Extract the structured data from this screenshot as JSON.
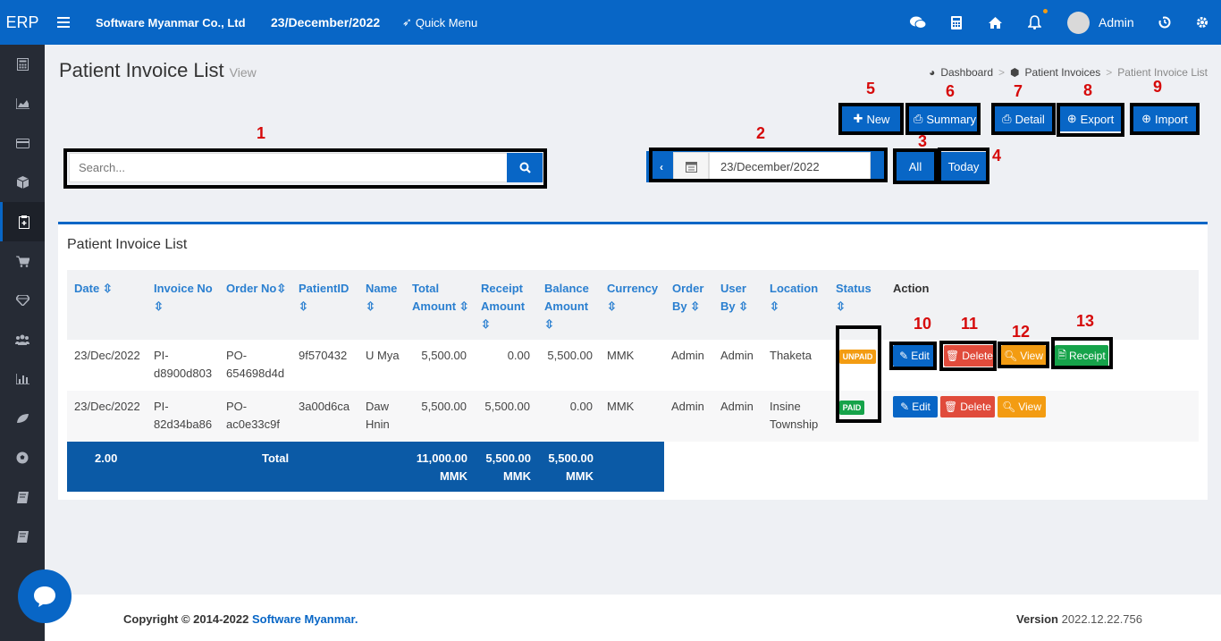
{
  "topbar": {
    "logo": "ERP",
    "company": "Software Myanmar Co., Ltd",
    "date": "23/December/2022",
    "quick_menu": "Quick Menu",
    "user": "Admin"
  },
  "page": {
    "title": "Patient Invoice List",
    "subtitle": "View",
    "breadcrumb": [
      "Dashboard",
      "Patient Invoices",
      "Patient Invoice List"
    ]
  },
  "toolbar": {
    "new": "New",
    "summary": "Summary",
    "detail": "Detail",
    "export": "Export",
    "import": "Import",
    "all": "All",
    "today": "Today"
  },
  "search": {
    "placeholder": "Search..."
  },
  "datefilter": {
    "value": "23/December/2022"
  },
  "annotations": [
    "1",
    "2",
    "3",
    "4",
    "5",
    "6",
    "7",
    "8",
    "9",
    "10",
    "11",
    "12",
    "13"
  ],
  "panel": {
    "title": "Patient Invoice List"
  },
  "table": {
    "headers": {
      "date": "Date",
      "invoice_no": "Invoice No",
      "order_no": "Order No",
      "patient_id": "PatientID",
      "name": "Name",
      "total_amount_1": "Total",
      "total_amount_2": "Amount",
      "receipt_amount_1": "Receipt",
      "receipt_amount_2": "Amount",
      "balance_amount_1": "Balance",
      "balance_amount_2": "Amount",
      "currency": "Currency",
      "order_by_1": "Order",
      "order_by_2": "By",
      "user_by_1": "User",
      "user_by_2": "By",
      "location": "Location",
      "status": "Status",
      "action": "Action"
    },
    "rows": [
      {
        "date": "23/Dec/2022",
        "inv1": "PI-",
        "inv2": "d8900d803",
        "ord1": "PO-",
        "ord2": "654698d4d",
        "pid": "9f570432",
        "name1": "U Mya",
        "name2": "",
        "total": "5,500.00",
        "receipt": "0.00",
        "balance": "5,500.00",
        "currency": "MMK",
        "order_by": "Admin",
        "user_by": "Admin",
        "loc1": "Thaketa",
        "loc2": "",
        "status": "UNPAID"
      },
      {
        "date": "23/Dec/2022",
        "inv1": "PI-",
        "inv2": "82d34ba86",
        "ord1": "PO-",
        "ord2": "ac0e33c9f",
        "pid": "3a00d6ca",
        "name1": "Daw",
        "name2": "Hnin",
        "total": "5,500.00",
        "receipt": "5,500.00",
        "balance": "0.00",
        "currency": "MMK",
        "order_by": "Admin",
        "user_by": "Admin",
        "loc1": "Insine",
        "loc2": "Township",
        "status": "PAID"
      }
    ],
    "actions": {
      "edit": "Edit",
      "delete": "Delete",
      "view": "View",
      "receipt": "Receipt"
    },
    "total_row": {
      "count": "2.00",
      "label": "Total",
      "total": "11,000.00",
      "receipt": "5,500.00",
      "balance": "5,500.00",
      "unit": "MMK"
    }
  },
  "footer": {
    "copyright": "Copyright © 2014-2022",
    "company": "Software Myanmar.",
    "version_label": "Version",
    "version": "2022.12.22.756"
  },
  "colors": {
    "primary": "#0866c6",
    "danger": "#e04b3b",
    "warning": "#f39c12",
    "success": "#16a34a"
  }
}
